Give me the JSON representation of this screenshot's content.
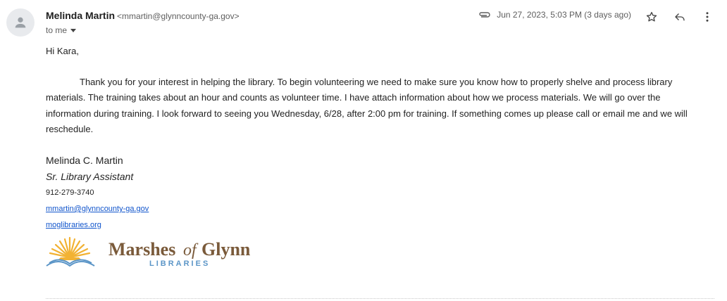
{
  "sender": {
    "name": "Melinda Martin",
    "email": "<mmartin@glynncounty-ga.gov>"
  },
  "recipient_label": "to me",
  "meta": {
    "date": "Jun 27, 2023, 5:03 PM (3 days ago)"
  },
  "icons": {
    "attachment": "paperclip-icon",
    "star": "star-icon",
    "reply": "reply-icon",
    "more": "more-vert-icon",
    "avatar": "person-icon"
  },
  "body": {
    "greeting": "Hi Kara,",
    "paragraph": "Thank you for your interest in helping the library. To begin volunteering we need to make sure you know how to properly shelve and process library materials. The training takes about an hour and counts as volunteer time.  I have attach information about how we process materials.  We will go over the information during training.  I look forward to seeing you Wednesday, 6/28, after 2:00 pm for training. If something comes up please call or email me and we will reschedule."
  },
  "signature": {
    "name": "Melinda C. Martin",
    "title": "Sr. Library Assistant",
    "phone": "912-279-3740",
    "email": "mmartin@glynncounty-ga.gov",
    "website": "moglibraries.org"
  },
  "logo": {
    "text_marshes": "Marshes",
    "text_of": "of",
    "text_glynn": "Glynn",
    "text_libraries": "LIBRARIES"
  },
  "colors": {
    "link": "#1155cc",
    "logo_brown": "#7a5a3a",
    "logo_blue": "#5b95c7",
    "logo_sun": "#f2b233"
  }
}
